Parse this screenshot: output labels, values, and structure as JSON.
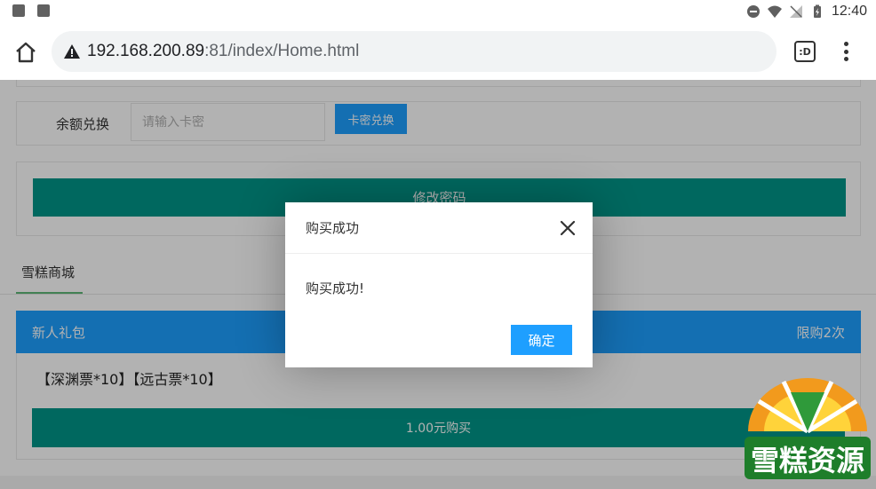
{
  "status_bar": {
    "time": "12:40",
    "icons": [
      "image-icon",
      "app-notification-icon",
      "do-not-disturb-icon",
      "wifi-icon",
      "no-signal-icon",
      "battery-charging-icon"
    ]
  },
  "browser": {
    "url_host": "192.168.200.89",
    "url_rest": ":81/index/Home.html",
    "tab_button_label": ":D",
    "icons": [
      "home-icon",
      "not-secure-warning-icon",
      "tab-switcher-icon",
      "overflow-menu-icon"
    ]
  },
  "redeem": {
    "label": "余额兑换",
    "input_placeholder": "请输入卡密",
    "input_value": "",
    "button_label": "卡密兑换"
  },
  "password": {
    "button_label": "修改密码"
  },
  "shop": {
    "tab_label": "雪糕商城",
    "package": {
      "title": "新人礼包",
      "limit": "限购2次",
      "items": "【深渊票*10】【远古票*10】",
      "buy_label": "1.00元购买"
    }
  },
  "dialog": {
    "title": "购买成功",
    "message": "购买成功!",
    "ok_label": "确定"
  },
  "watermark": {
    "text": "雪糕资源"
  },
  "colors": {
    "primary_blue": "#1e9fff",
    "teal": "#009688",
    "tab_underline": "#5fb878",
    "overlay": "rgba(0,0,0,0.3)"
  }
}
